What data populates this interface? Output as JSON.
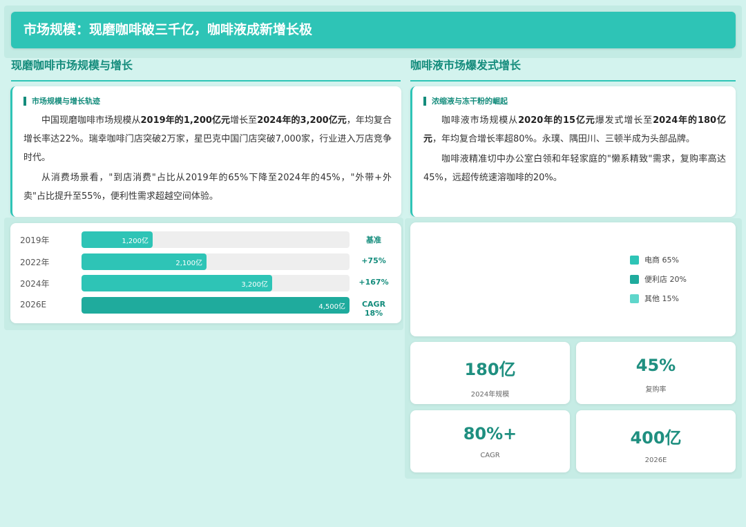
{
  "header": {
    "title": "市场规模：现磨咖啡破三千亿，咖啡液成新增长极"
  },
  "left": {
    "section_title": "现磨咖啡市场规模与增长",
    "card_subtitle": "市场规模与增长轨迹",
    "p1": {
      "t1": "中国现磨咖啡市场规模从",
      "b1": "2019年的1,200亿元",
      "t2": "增长至",
      "b2": "2024年的3,200亿元",
      "t3": "，年均复合增长率达22%。瑞幸咖啡门店突破2万家，星巴克中国门店突破7,000家，行业进入万店竞争时代。"
    },
    "p2": "从消费场景看，\"到店消费\"占比从2019年的65%下降至2024年的45%，\"外带+外卖\"占比提升至55%，便利性需求超越空间体验。",
    "bars": [
      {
        "year": "2019年",
        "value": 1200,
        "label": "1,200亿",
        "growth": "基准"
      },
      {
        "year": "2022年",
        "value": 2100,
        "label": "2,100亿",
        "growth": "+75%"
      },
      {
        "year": "2024年",
        "value": 3200,
        "label": "3,200亿",
        "growth": "+167%"
      },
      {
        "year": "2026E",
        "value": 4500,
        "label": "4,500亿",
        "growth": "CAGR 18%"
      }
    ],
    "bar_max": 4500
  },
  "right": {
    "section_title": "咖啡液市场爆发式增长",
    "card_subtitle": "浓缩液与冻干粉的崛起",
    "p1": {
      "t1": "咖啡液市场规模从",
      "b1": "2020年的15亿元",
      "t2": "爆发式增长至",
      "b2": "2024年的180亿元",
      "t3": "，年均复合增长率超80%。永璞、隅田川、三顿半成为头部品牌。"
    },
    "p2": "咖啡液精准切中办公室白领和年轻家庭的\"懒系精致\"需求，复购率高达45%，远超传统速溶咖啡的20%。",
    "legend": [
      {
        "label": "电商 65%",
        "color": "#2ec4b6"
      },
      {
        "label": "便利店 20%",
        "color": "#1fab9d"
      },
      {
        "label": "其他 15%",
        "color": "#5fd6cb"
      }
    ],
    "stats": [
      {
        "value": "180亿",
        "label": "2024年规模"
      },
      {
        "value": "45%",
        "label": "复购率"
      },
      {
        "value": "80%+",
        "label": "CAGR"
      },
      {
        "value": "400亿",
        "label": "2026E"
      }
    ]
  },
  "colors": {
    "accent": "#2ec4b6",
    "accent_dark": "#148c7c",
    "background": "#d3f3ee"
  }
}
